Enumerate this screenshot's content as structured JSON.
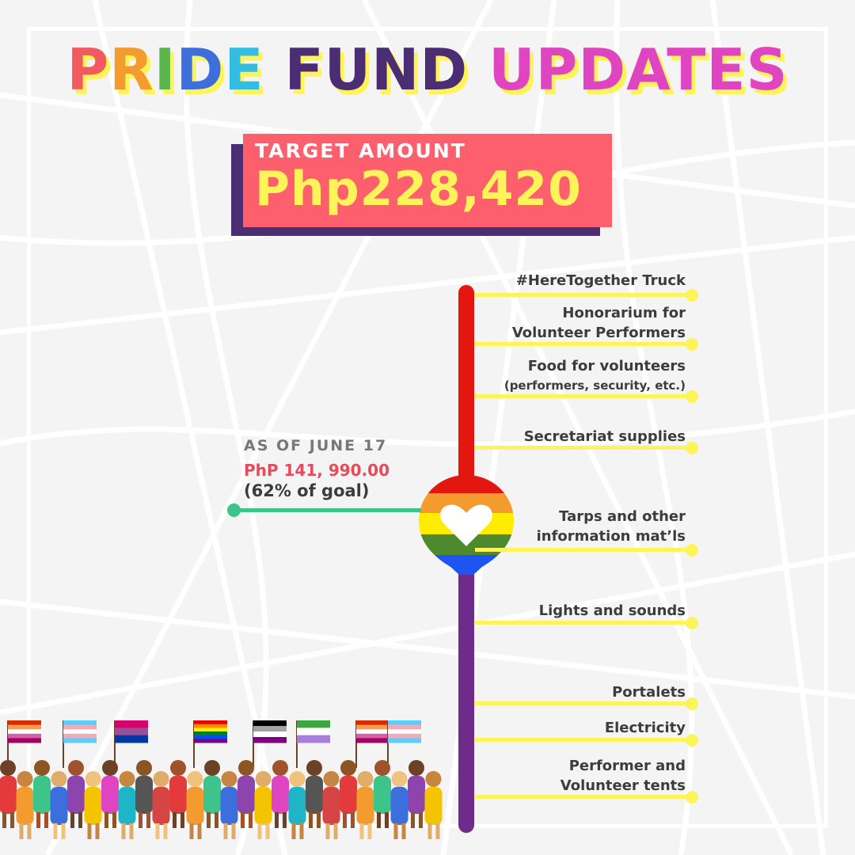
{
  "title": {
    "word1": "PRIDE",
    "word2": "FUND",
    "word3": "UPDATES",
    "colors": {
      "rainbow": [
        "#f25a5f",
        "#f39b2f",
        "#5ab64a",
        "#3d6fdc",
        "#33bde3"
      ],
      "fund": "#4b2d73",
      "updates": "#e045c1",
      "shadow": "#fff35a"
    }
  },
  "target": {
    "label": "TARGET AMOUNT",
    "amount": "Php228,420"
  },
  "progress": {
    "date": "AS OF JUNE 17",
    "amount": "PhP 141, 990.00",
    "percent_label": "(62% of goal)",
    "fraction_of_goal": 0.62
  },
  "pin_icon": "heart-icon",
  "expenses": [
    {
      "line1": "#HereTogether Truck"
    },
    {
      "line1": "Honorarium for",
      "line2": "Volunteer Performers"
    },
    {
      "line1": "Food for volunteers",
      "line2": "(performers, security, etc.)"
    },
    {
      "line1": "Secretariat supplies"
    },
    {
      "line1": "Tarps and other",
      "line2": "information mat’ls"
    },
    {
      "line1": "Lights and sounds"
    },
    {
      "line1": "Portalets"
    },
    {
      "line1": "Electricity"
    },
    {
      "line1": "Performer and",
      "line2": "Volunteer tents"
    }
  ],
  "colors": {
    "background": "#f4f4f4",
    "target_box": "#fe5f6c",
    "target_shadow": "#4b2d73",
    "accent_yellow": "#fff35a",
    "progress_green": "#3cc48a",
    "spine_red": "#e3170f",
    "spine_purple": "#6f2b8a"
  }
}
